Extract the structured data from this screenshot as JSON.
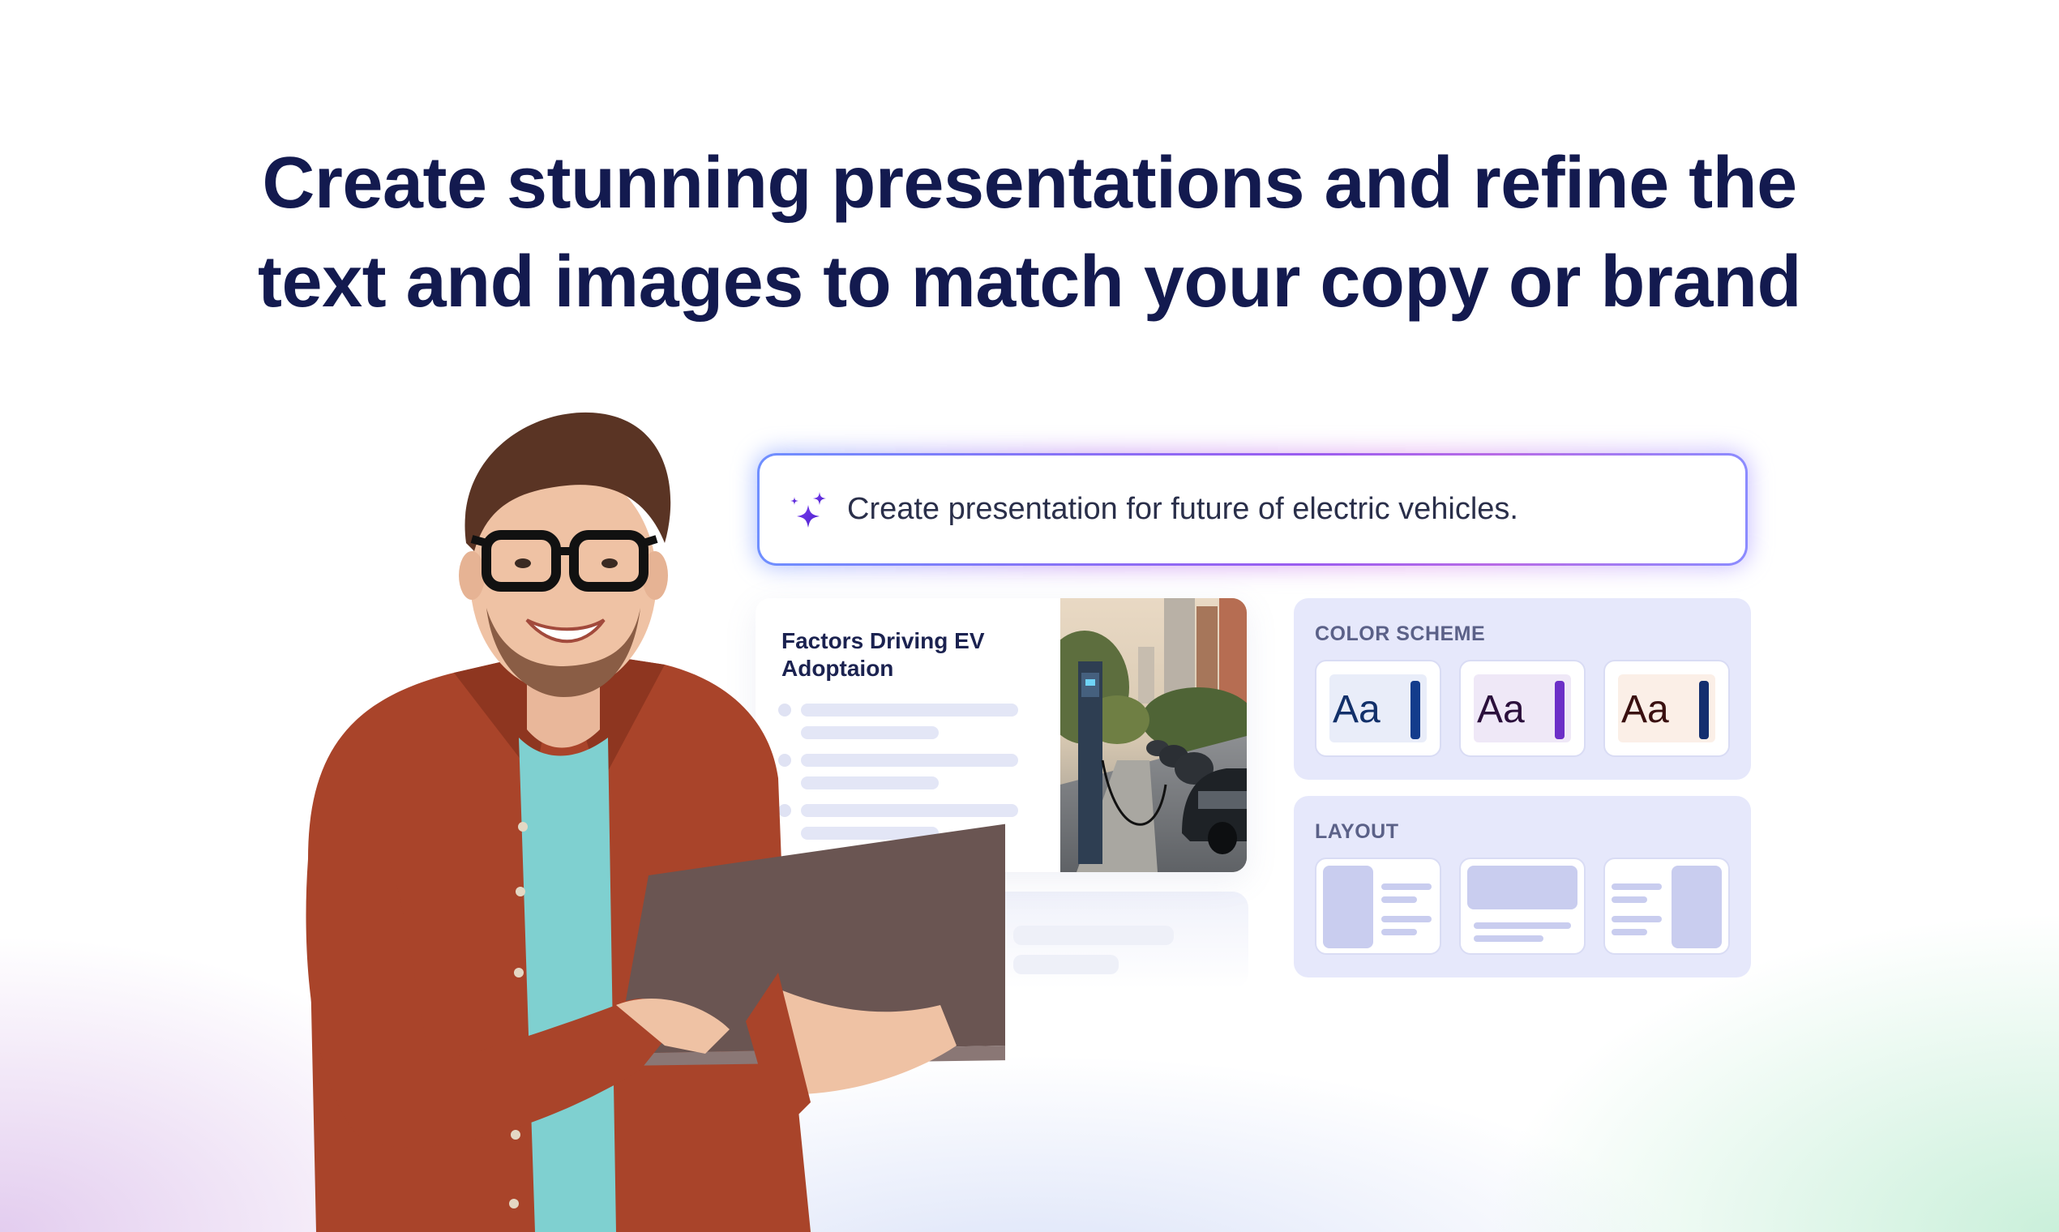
{
  "headline": {
    "line1": "Create stunning presentations and refine the",
    "line2": "text and images to match your copy or brand"
  },
  "prompt": {
    "icon": "sparkle-icon",
    "text": "Create presentation for future of electric vehicles."
  },
  "slide": {
    "title": "Factors Driving EV Adoptaion",
    "image": "ev-charging-street-photo"
  },
  "color_scheme": {
    "title": "COLOR SCHEME",
    "options": [
      {
        "label": "Aa",
        "text_color": "#12306a",
        "bg": "#e9edf9",
        "bar": "#133c8c"
      },
      {
        "label": "Aa",
        "text_color": "#2b0f3c",
        "bg": "#efe8f7",
        "bar": "#6c2fc7"
      },
      {
        "label": "Aa",
        "text_color": "#3a1010",
        "bg": "#fbefe7",
        "bar": "#142f6f"
      }
    ]
  },
  "layout": {
    "title": "LAYOUT",
    "options": [
      "image-left",
      "image-top",
      "image-right"
    ]
  },
  "colors": {
    "headline": "#131a4f",
    "panel_bg": "#e6e8fb",
    "accent_purple": "#9a5cf0"
  }
}
